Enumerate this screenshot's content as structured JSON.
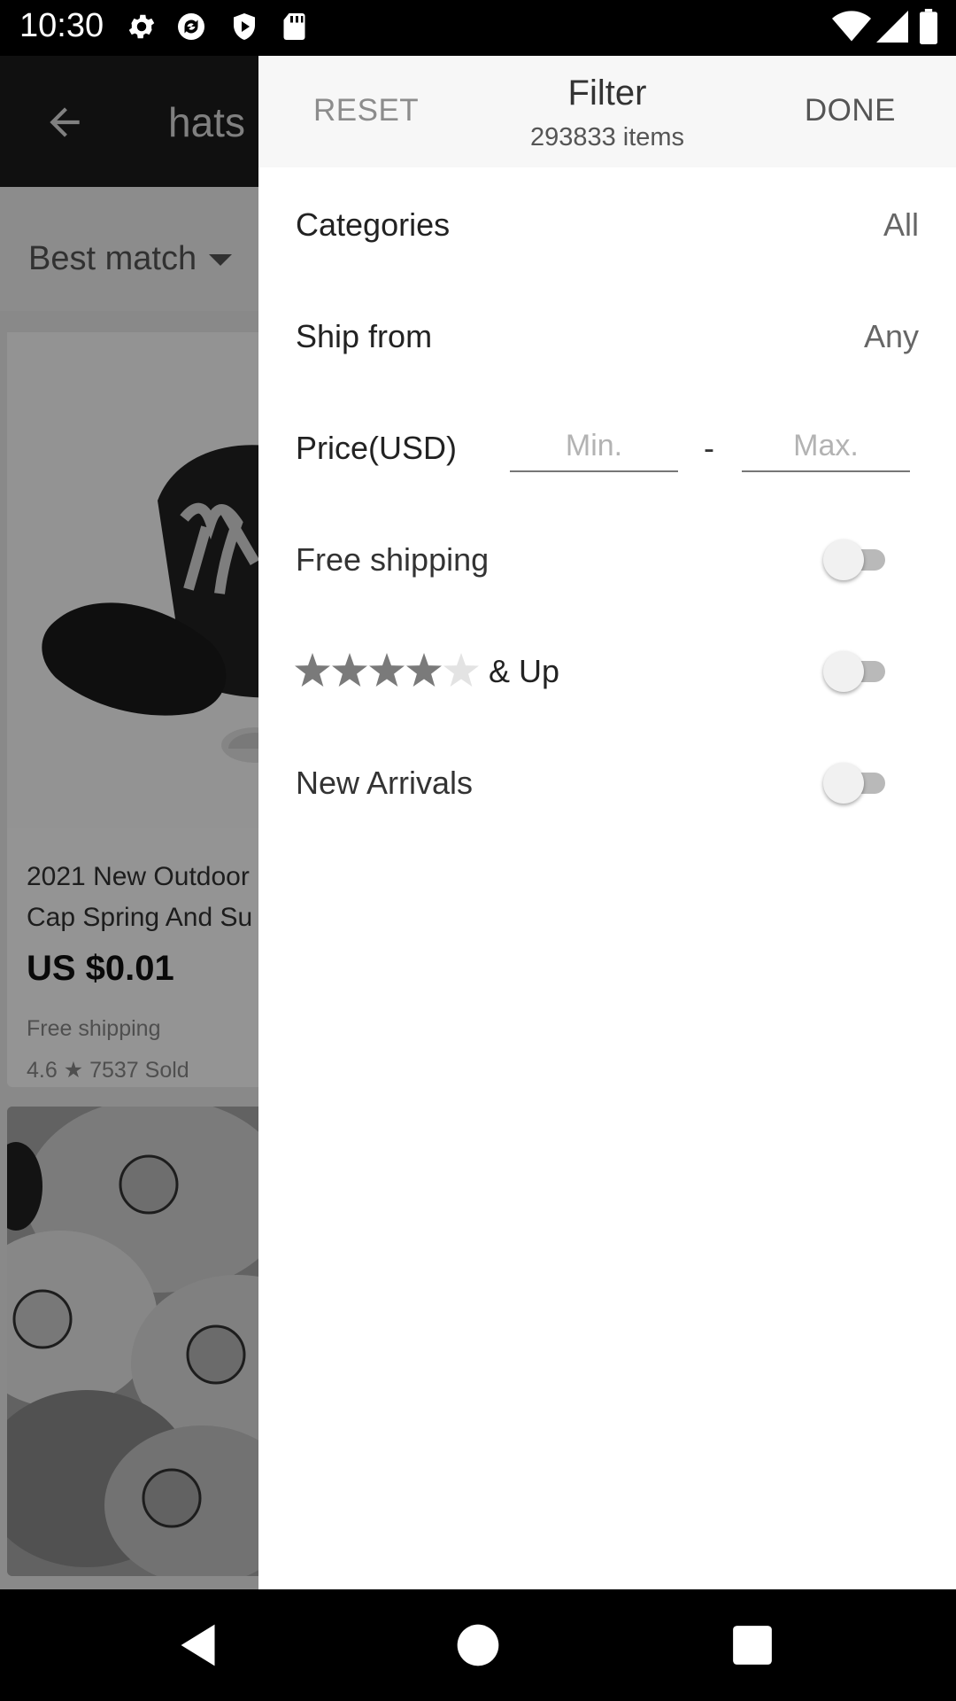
{
  "status_bar": {
    "time": "10:30",
    "icons": [
      "settings-icon",
      "sync-icon",
      "shield-play-icon",
      "sd-card-icon"
    ],
    "right_icons": [
      "wifi-icon",
      "cellular-icon",
      "battery-icon"
    ]
  },
  "background_app": {
    "search_query": "hats",
    "sort_label": "Best match",
    "product": {
      "title": "2021 New Outdoor\nCap Spring And Su",
      "price": "US $0.01",
      "shipping": "Free shipping",
      "rating": "4.6",
      "sold": "7537 Sold"
    }
  },
  "filter": {
    "reset_label": "RESET",
    "title": "Filter",
    "item_count": "293833 items",
    "done_label": "DONE",
    "categories": {
      "label": "Categories",
      "value": "All"
    },
    "ship_from": {
      "label": "Ship from",
      "value": "Any"
    },
    "price": {
      "label": "Price(USD)",
      "min_placeholder": "Min.",
      "separator": "-",
      "max_placeholder": "Max."
    },
    "free_shipping": {
      "label": "Free shipping",
      "enabled": false
    },
    "rating_filter": {
      "stars": 4,
      "out_of": 5,
      "suffix": "& Up",
      "enabled": false
    },
    "new_arrivals": {
      "label": "New Arrivals",
      "enabled": false
    }
  },
  "colors": {
    "drawer_bg": "#ffffff",
    "header_bg": "#f7f7f7",
    "star_filled": "#7a7a7a",
    "star_empty": "#e3e3e3",
    "toggle_track_off": "#b9b9b9"
  }
}
